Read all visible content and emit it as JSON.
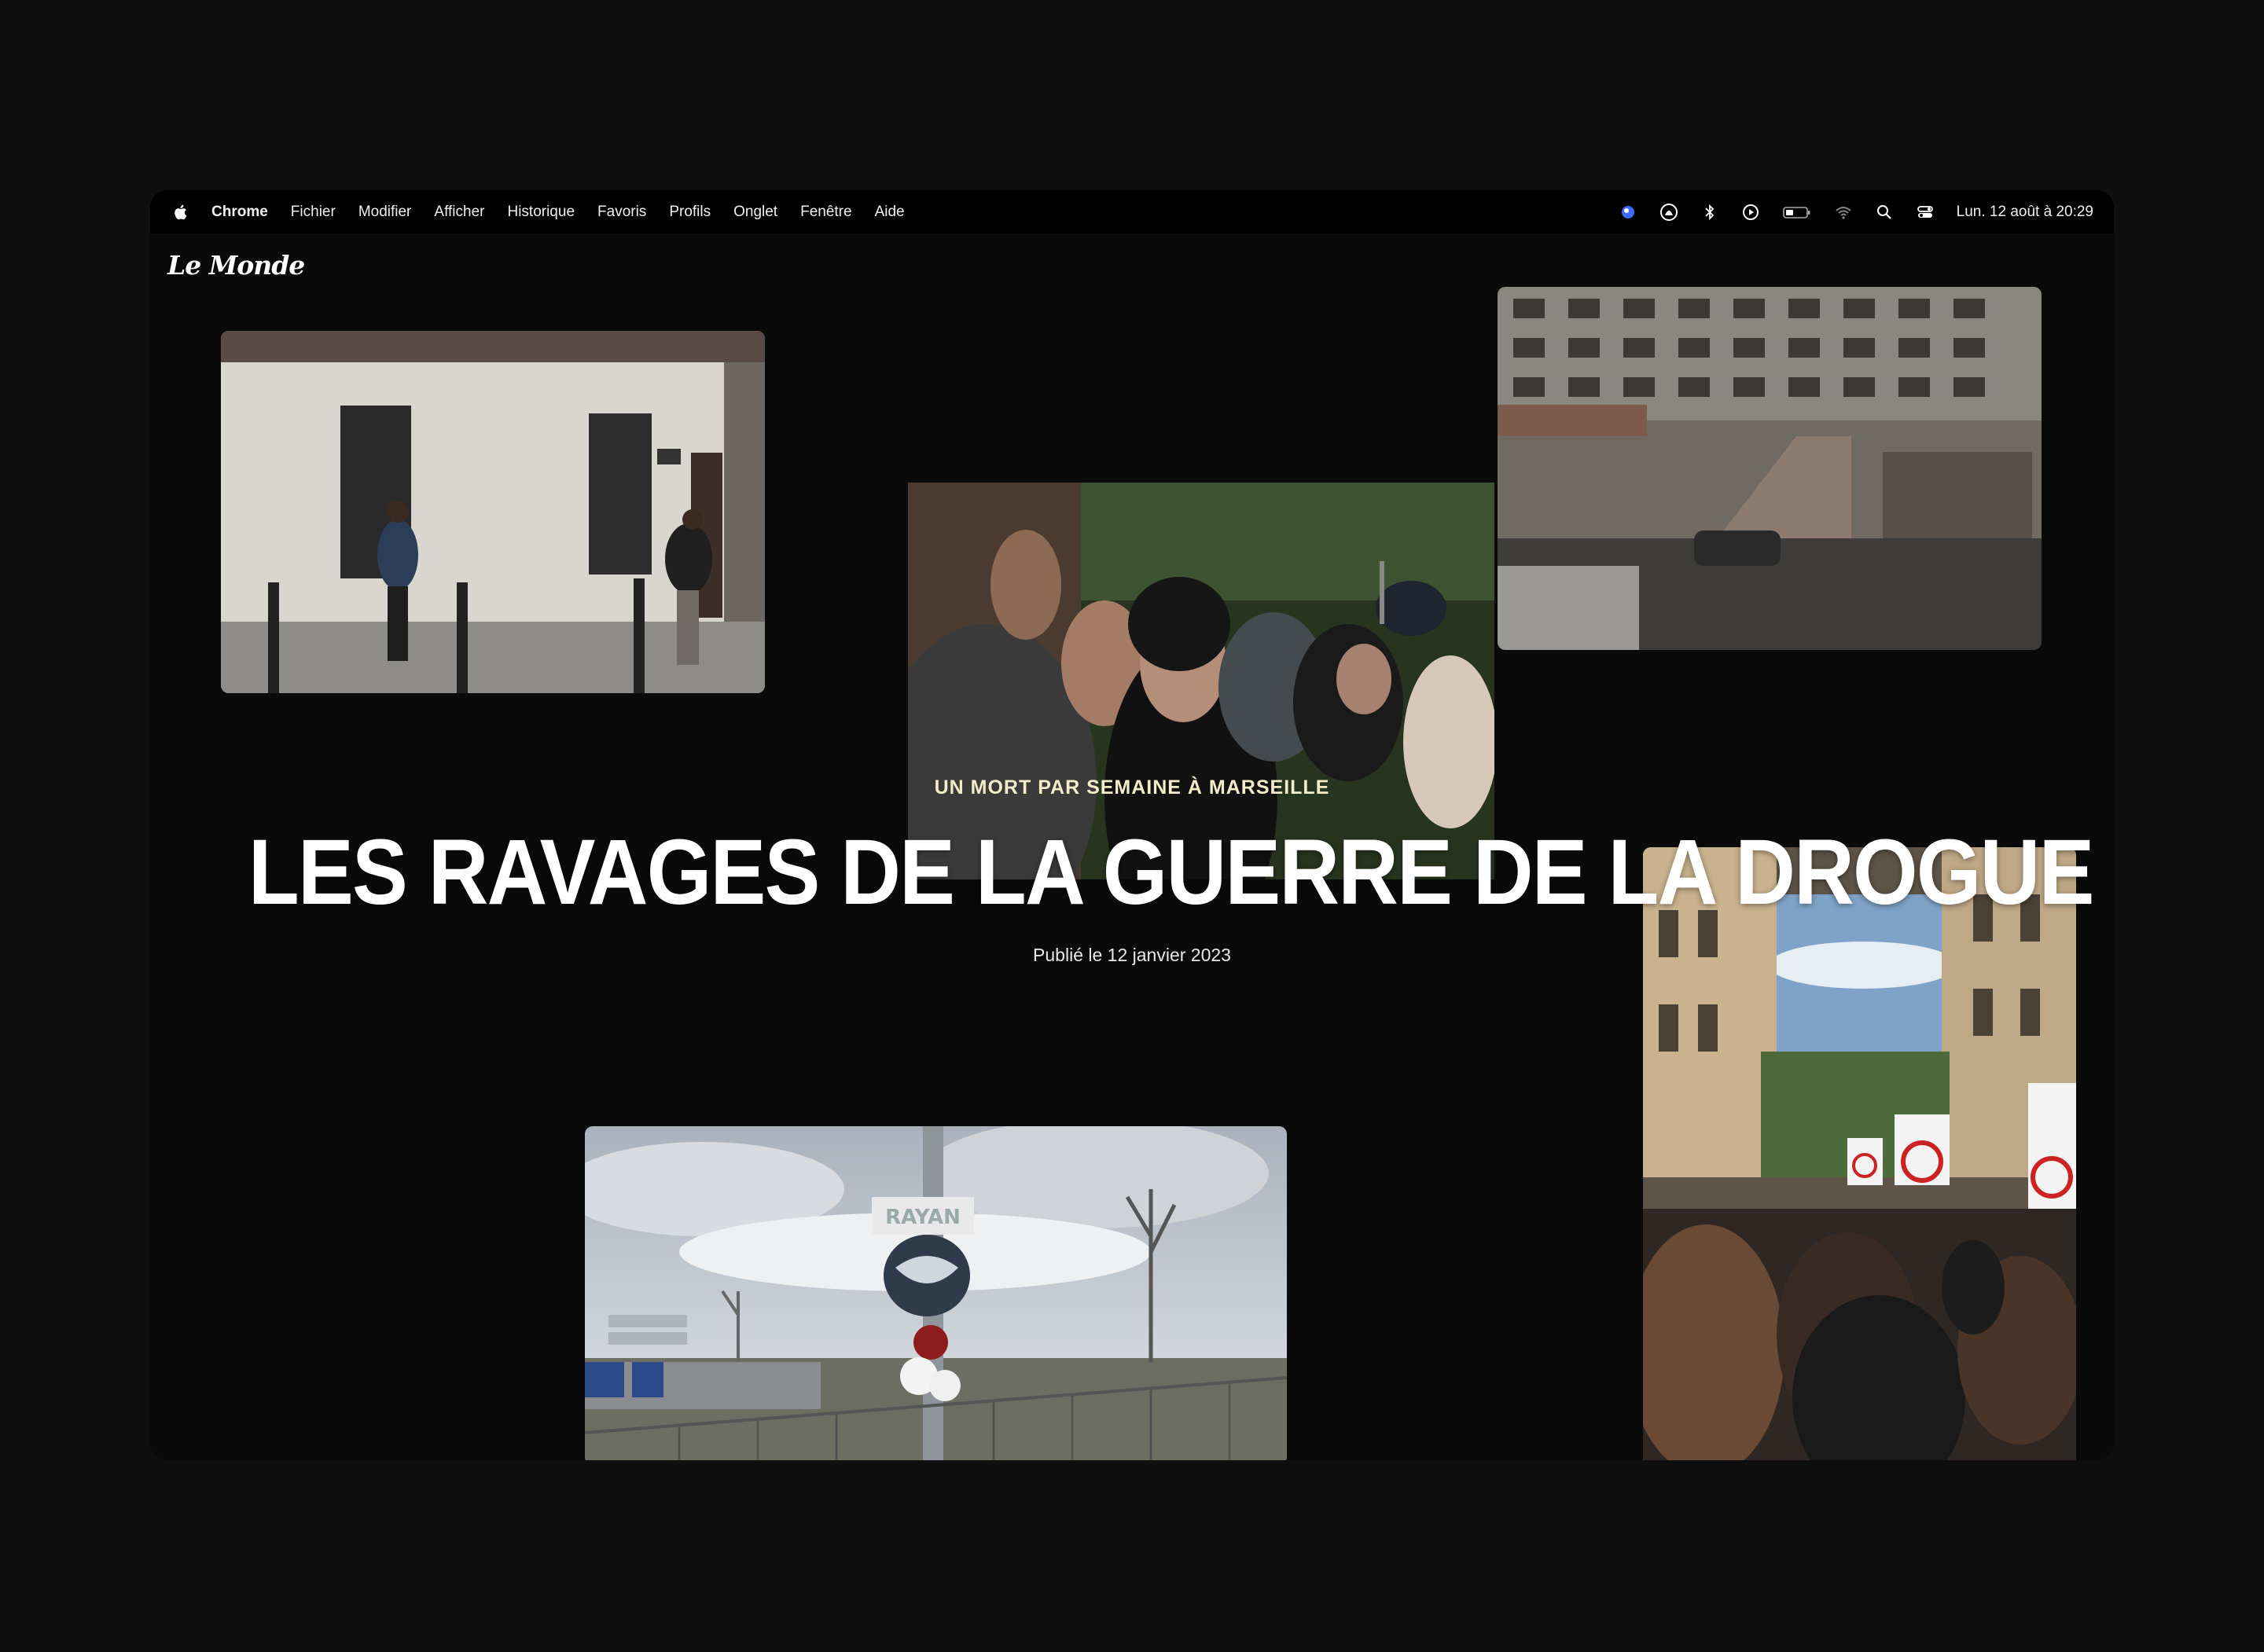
{
  "menubar": {
    "apple_icon": "apple-logo-icon",
    "items": [
      "Chrome",
      "Fichier",
      "Modifier",
      "Afficher",
      "Historique",
      "Favoris",
      "Profils",
      "Onglet",
      "Fenêtre",
      "Aide"
    ],
    "status_icons": [
      "user-profile-icon",
      "siri-icon",
      "bluetooth-icon",
      "play-icon",
      "battery-icon",
      "wifi-icon",
      "search-icon",
      "control-center-icon"
    ],
    "clock": "Lun. 12 août à  20:29"
  },
  "page": {
    "logo": "Le Monde",
    "kicker": "UN MORT PAR SEMAINE À MARSEILLE",
    "headline": "LES RAVAGES DE LA GUERRE DE LA DROGUE",
    "published": "Publié le 12 janvier 2023",
    "memorial_sign": "RAYAN"
  },
  "colors": {
    "background": "#0a0a0a",
    "kicker": "#f2ecc8",
    "headline": "#ffffff"
  }
}
